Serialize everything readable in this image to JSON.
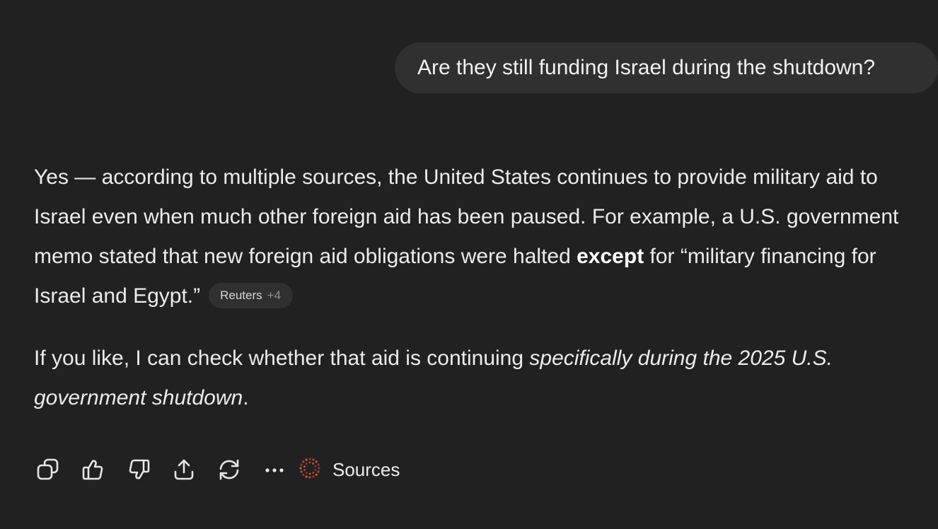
{
  "user_message": {
    "text": "Are they still funding Israel during the shutdown?"
  },
  "assistant_message": {
    "p1_part1": "Yes — according to multiple sources, the United States continues to provide military aid to Israel even when much other foreign aid has been paused. For example, a U.S. government memo stated that new foreign aid obligations were halted ",
    "p1_bold": "except",
    "p1_part2": " for “military financing for Israel and Egypt.”",
    "citation": {
      "source": "Reuters",
      "more": "+4"
    },
    "p2_part1": "If you like, I can check whether that aid is continuing ",
    "p2_italic": "specifically during the 2025 U.S. government shutdown",
    "p2_part2": "."
  },
  "toolbar": {
    "actions": [
      "copy-icon",
      "thumbs-up-icon",
      "thumbs-down-icon",
      "share-icon",
      "regenerate-icon",
      "more-icon"
    ],
    "sources_label": "Sources",
    "accent_color": "#e8532f"
  }
}
